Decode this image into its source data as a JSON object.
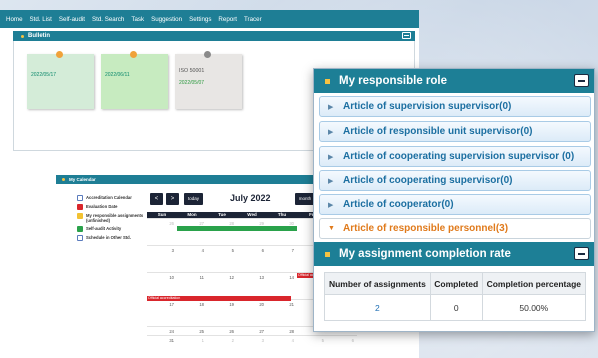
{
  "colors": {
    "teal_header": "#1d7f96",
    "orange_active": "#e07a1b",
    "blue_link": "#1c6fa1"
  },
  "nav": [
    "Home",
    "Std. List",
    "Self-audit",
    "Std. Search",
    "Task",
    "Suggestion",
    "Settings",
    "Report",
    "Tracer"
  ],
  "bulletin": {
    "title": "Bulletin",
    "notes": [
      {
        "line1": "",
        "line2": "2022/05/17"
      },
      {
        "line1": "",
        "line2": "2022/06/11"
      },
      {
        "line1": "ISO 50001",
        "line2": "2022/05/07"
      }
    ]
  },
  "calendar": {
    "title": "My Calendar",
    "legend": [
      {
        "label": "Accreditation Calendar",
        "color": "#ffffff",
        "checked": false
      },
      {
        "label": "Evaluation Date",
        "color": "#d9262c",
        "checked": true
      },
      {
        "label": "My responsible assignments (unfinished)",
        "color": "#f2c232",
        "checked": false
      },
      {
        "label": "Self-audit Activity",
        "color": "#2aa24b",
        "checked": true
      },
      {
        "label": "Schedule in Other Std.",
        "color": "#ffffff",
        "checked": false
      }
    ],
    "prev": "<",
    "next": ">",
    "today": "today",
    "month_title": "July 2022",
    "month_btn": "month",
    "days": [
      "Sun",
      "Mon",
      "Tue",
      "Wed",
      "Thu",
      "Fri",
      ""
    ],
    "weeks": [
      [
        "26",
        "27",
        "28",
        "29",
        "30",
        "",
        ""
      ],
      [
        "3",
        "4",
        "5",
        "6",
        "7",
        "",
        ""
      ],
      [
        "10",
        "11",
        "12",
        "13",
        "14",
        "",
        ""
      ],
      [
        "17",
        "18",
        "19",
        "20",
        "21",
        "",
        ""
      ],
      [
        "24",
        "25",
        "26",
        "27",
        "28",
        "",
        ""
      ],
      [
        "31",
        "1",
        "2",
        "3",
        "4",
        "5",
        "6"
      ]
    ],
    "event1": "Official accreditation",
    "event2": "Official accreditation"
  },
  "popup": {
    "role_title": "My responsible role",
    "articles": [
      "Article of supervision supervisor(0)",
      "Article of responsible unit supervisor(0)",
      "Article of cooperating supervision supervisor (0)",
      "Article of cooperating supervisor(0)",
      "Article of cooperator(0)",
      "Article of responsible personnel(3)"
    ],
    "active_index": 5,
    "assign_title": "My assignment completion rate",
    "table": {
      "headers": [
        "Number of assignments",
        "Completed",
        "Completion percentage"
      ],
      "row": [
        "2",
        "0",
        "50.00%"
      ]
    }
  }
}
